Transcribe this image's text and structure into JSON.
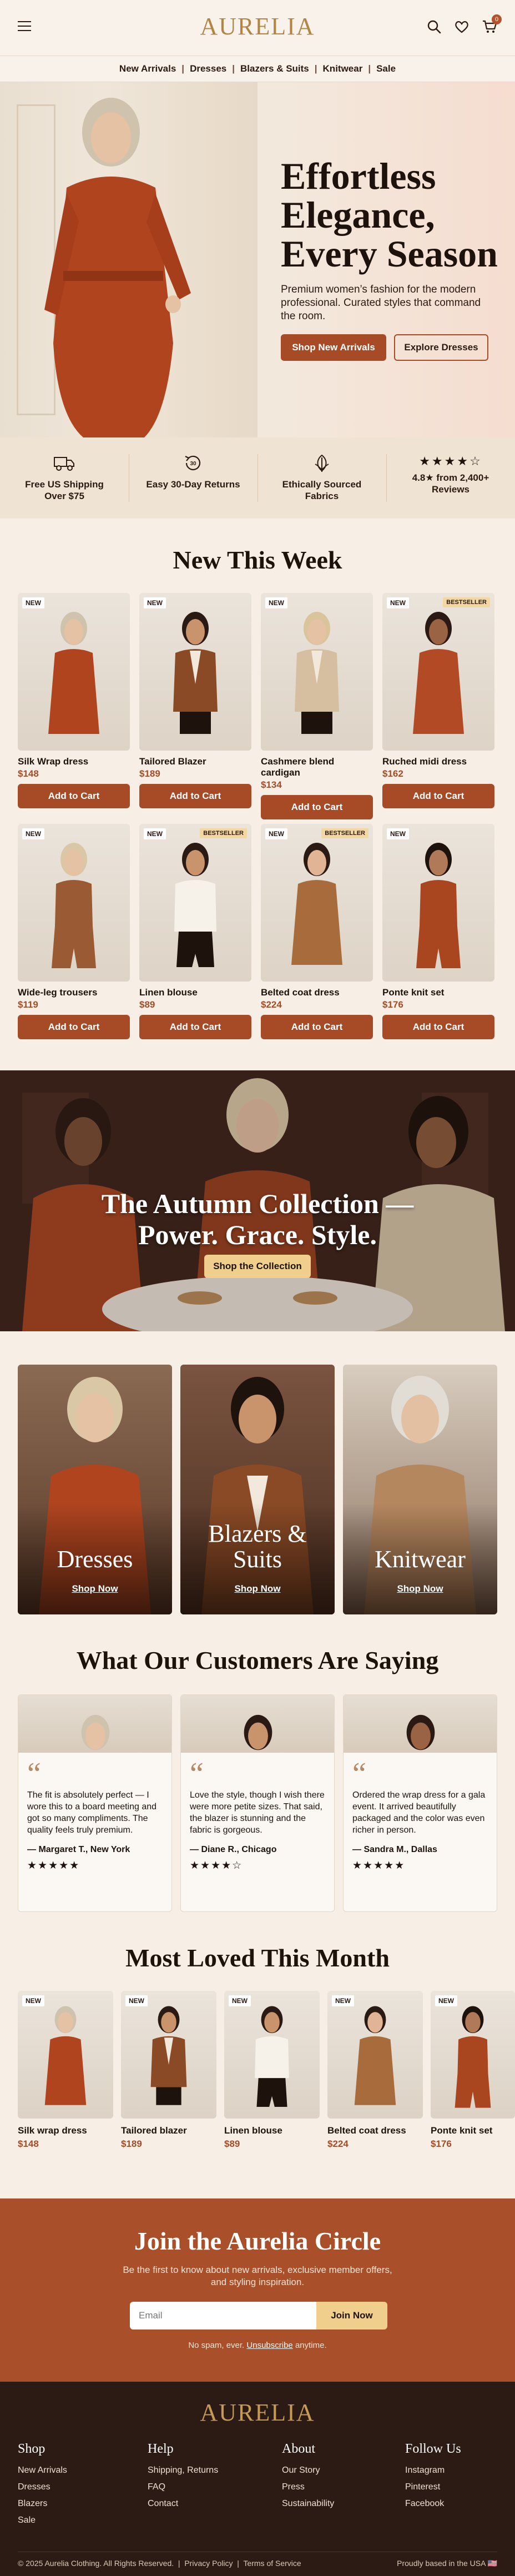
{
  "brand": {
    "logo": "AURELIA",
    "accent": "#a74b26",
    "gold": "#b08546"
  },
  "header": {
    "cart_count": "0",
    "icons": [
      "menu-icon",
      "search-icon",
      "heart-icon",
      "cart-icon"
    ]
  },
  "nav": {
    "items": [
      "New Arrivals",
      "Dresses",
      "Blazers & Suits",
      "Knitwear",
      "Sale"
    ]
  },
  "hero": {
    "title_line1": "Effortless",
    "title_line2": "Elegance,",
    "title_line3": "Every Season",
    "subtitle": "Premium women’s fashion for the modern professional. Curated styles that command the room.",
    "primary_cta": "Shop New Arrivals",
    "secondary_cta": "Explore Dresses"
  },
  "perks": [
    {
      "icon": "truck-icon",
      "text": "Free US Shipping Over $75"
    },
    {
      "icon": "returns-icon",
      "text": "Easy 30-Day Returns"
    },
    {
      "icon": "leaf-icon",
      "text": "Ethically Sourced Fabrics"
    },
    {
      "icon": "stars-icon",
      "stars": "★★★★☆",
      "text": "4.8★ from 2,400+ Reviews"
    }
  ],
  "new_this_week": {
    "title": "New This Week",
    "add_to_cart": "Add to Cart",
    "new_tag": "NEW",
    "best_tag": "BESTSELLER",
    "products": [
      {
        "name": "Silk Wrap dress",
        "price": "$148",
        "bestseller": false
      },
      {
        "name": "Tailored Blazer",
        "price": "$189",
        "bestseller": false
      },
      {
        "name": "Cashmere blend cardigan",
        "price": "$134",
        "bestseller": false
      },
      {
        "name": "Ruched midi dress",
        "price": "$162",
        "bestseller": true
      },
      {
        "name": "Wide-leg trousers",
        "price": "$119",
        "bestseller": false
      },
      {
        "name": "Linen blouse",
        "price": "$89",
        "bestseller": true
      },
      {
        "name": "Belted coat dress",
        "price": "$224",
        "bestseller": true
      },
      {
        "name": "Ponte knit set",
        "price": "$176",
        "bestseller": false
      }
    ]
  },
  "autumn": {
    "title_line1": "The Autumn Collection —",
    "title_line2": "Power. Grace. Style.",
    "cta": "Shop the Collection"
  },
  "categories": [
    {
      "line1": "Dresses",
      "line2": "",
      "cta": "Shop Now"
    },
    {
      "line1": "Blazers &",
      "line2": "Suits",
      "cta": "Shop Now"
    },
    {
      "line1": "Knitwear",
      "line2": "",
      "cta": "Shop Now"
    }
  ],
  "testimonials": {
    "title": "What Our Customers Are Saying",
    "quote_glyph": "“",
    "items": [
      {
        "text": "The fit is absolutely perfect — I wore this to a board meeting and got so many compliments. The quality feels truly premium.",
        "author": "— Margaret T., New York",
        "stars": "★★★★★"
      },
      {
        "text": "Love the style, though I wish there were more petite sizes. That said, the blazer is stunning and the fabric is gorgeous.",
        "author": "— Diane R., Chicago",
        "stars": "★★★★☆"
      },
      {
        "text": "Ordered the wrap dress for a gala event. It arrived beautifully packaged and the color was even richer in person.",
        "author": "— Sandra M., Dallas",
        "stars": "★★★★★"
      }
    ]
  },
  "most_loved": {
    "title": "Most Loved This Month",
    "new_tag": "NEW",
    "products": [
      {
        "name": "Silk wrap dress",
        "price": "$148"
      },
      {
        "name": "Tailored blazer",
        "price": "$189"
      },
      {
        "name": "Linen blouse",
        "price": "$89"
      },
      {
        "name": "Belted coat dress",
        "price": "$224"
      },
      {
        "name": "Ponte knit set",
        "price": "$176"
      }
    ]
  },
  "newsletter": {
    "title": "Join the Aurelia Circle",
    "subtitle": "Be the first to know about new arrivals, exclusive member offers, and styling inspiration.",
    "placeholder": "Email",
    "cta": "Join Now",
    "note_prefix": "No spam, ever.",
    "note_link": "Unsubscribe",
    "note_suffix": "anytime."
  },
  "footer": {
    "logo": "AURELIA",
    "columns": [
      {
        "title": "Shop",
        "links": [
          "New Arrivals",
          "Dresses",
          "Blazers",
          "Sale"
        ]
      },
      {
        "title": "Help",
        "links": [
          "Shipping, Returns",
          "FAQ",
          "Contact"
        ]
      },
      {
        "title": "About",
        "links": [
          "Our Story",
          "Press",
          "Sustainability"
        ]
      },
      {
        "title": "Follow Us",
        "links": [
          "Instagram",
          "Pinterest",
          "Facebook"
        ]
      }
    ],
    "copyright": "© 2025 Aurelia Clothing. All Rights Reserved.",
    "privacy": "Privacy Policy",
    "terms": "Terms of Service",
    "made_in": "Proudly based in the USA 🇺🇸"
  }
}
